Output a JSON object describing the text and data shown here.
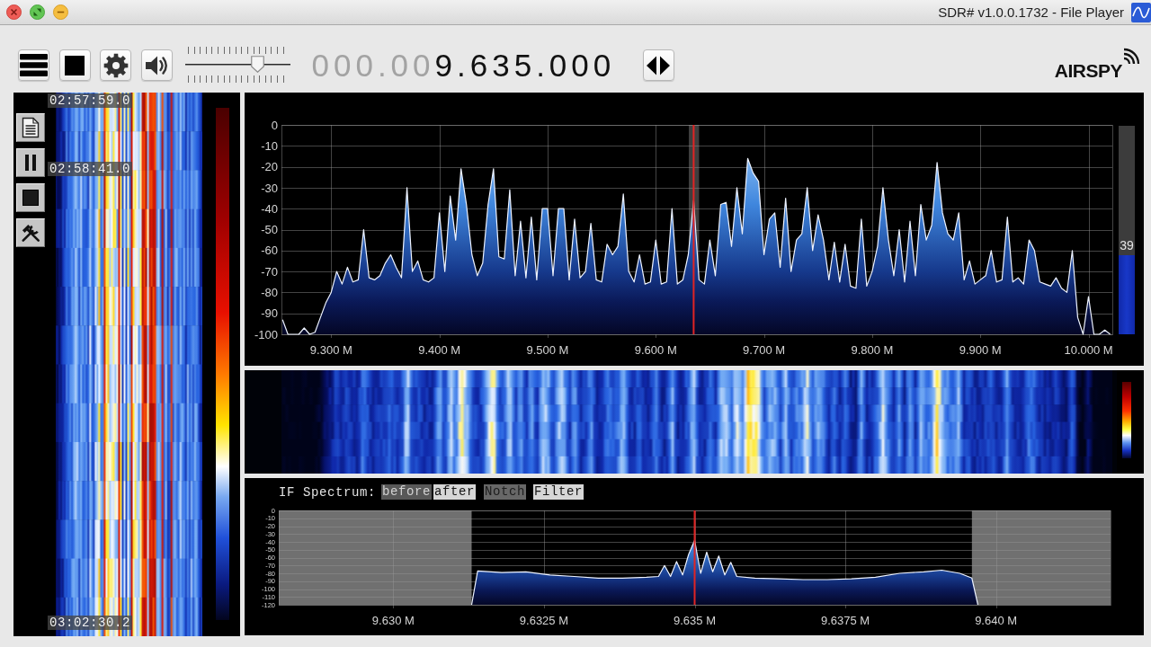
{
  "window": {
    "title": "SDR# v1.0.0.1732 - File Player"
  },
  "toolbar": {
    "volume": {
      "level": 0.69
    },
    "frequency": {
      "leading_zeros": "000.00",
      "digits": "9.635.000"
    },
    "logo": "AIRSPY"
  },
  "left_panel": {
    "timestamps": [
      "02:57:59.0",
      "02:58:41.0",
      "03:02:30.2"
    ]
  },
  "spectrum": {
    "chart_data": {
      "type": "area",
      "color": "#3f86dd",
      "x": [
        9.255,
        9.26,
        9.265,
        9.27,
        9.275,
        9.28,
        9.285,
        9.29,
        9.295,
        9.3,
        9.305,
        9.31,
        9.315,
        9.32,
        9.325,
        9.33,
        9.335,
        9.34,
        9.345,
        9.35,
        9.355,
        9.36,
        9.365,
        9.37,
        9.375,
        9.38,
        9.385,
        9.39,
        9.395,
        9.4,
        9.405,
        9.41,
        9.415,
        9.42,
        9.425,
        9.43,
        9.435,
        9.44,
        9.445,
        9.45,
        9.455,
        9.46,
        9.465,
        9.47,
        9.475,
        9.48,
        9.485,
        9.49,
        9.495,
        9.5,
        9.505,
        9.51,
        9.515,
        9.52,
        9.525,
        9.53,
        9.535,
        9.54,
        9.545,
        9.55,
        9.555,
        9.56,
        9.565,
        9.57,
        9.575,
        9.58,
        9.585,
        9.59,
        9.595,
        9.6,
        9.605,
        9.61,
        9.615,
        9.62,
        9.625,
        9.63,
        9.635,
        9.64,
        9.645,
        9.65,
        9.655,
        9.66,
        9.665,
        9.67,
        9.675,
        9.68,
        9.685,
        9.69,
        9.695,
        9.7,
        9.705,
        9.71,
        9.715,
        9.72,
        9.725,
        9.73,
        9.735,
        9.74,
        9.745,
        9.75,
        9.755,
        9.76,
        9.765,
        9.77,
        9.775,
        9.78,
        9.785,
        9.79,
        9.795,
        9.8,
        9.805,
        9.81,
        9.815,
        9.82,
        9.825,
        9.83,
        9.835,
        9.84,
        9.845,
        9.85,
        9.855,
        9.86,
        9.865,
        9.87,
        9.875,
        9.88,
        9.885,
        9.89,
        9.895,
        9.9,
        9.905,
        9.91,
        9.915,
        9.92,
        9.925,
        9.93,
        9.935,
        9.94,
        9.945,
        9.95,
        9.955,
        9.96,
        9.965,
        9.97,
        9.975,
        9.98,
        9.985,
        9.99,
        9.995,
        10.0,
        10.005,
        10.01,
        10.015,
        10.02
      ],
      "values": [
        -93,
        -100,
        -100,
        -100,
        -97,
        -100,
        -99,
        -92,
        -85,
        -80,
        -70,
        -76,
        -68,
        -75,
        -74,
        -50,
        -73,
        -74,
        -72,
        -66,
        -62,
        -68,
        -73,
        -30,
        -70,
        -65,
        -74,
        -75,
        -73,
        -42,
        -70,
        -34,
        -55,
        -21,
        -38,
        -62,
        -72,
        -66,
        -38,
        -21,
        -63,
        -64,
        -31,
        -72,
        -46,
        -73,
        -44,
        -74,
        -40,
        -40,
        -72,
        -40,
        -40,
        -74,
        -45,
        -73,
        -70,
        -47,
        -74,
        -75,
        -57,
        -62,
        -58,
        -33,
        -70,
        -75,
        -62,
        -76,
        -75,
        -55,
        -76,
        -75,
        -40,
        -76,
        -74,
        -62,
        -36,
        -74,
        -76,
        -55,
        -72,
        -38,
        -37,
        -58,
        -30,
        -52,
        -16,
        -23,
        -27,
        -62,
        -45,
        -42,
        -68,
        -35,
        -70,
        -55,
        -52,
        -30,
        -60,
        -43,
        -55,
        -74,
        -56,
        -75,
        -57,
        -77,
        -78,
        -45,
        -77,
        -70,
        -58,
        -30,
        -55,
        -72,
        -50,
        -75,
        -46,
        -72,
        -38,
        -55,
        -48,
        -18,
        -42,
        -52,
        -55,
        -42,
        -74,
        -65,
        -76,
        -74,
        -72,
        -60,
        -75,
        -74,
        -44,
        -75,
        -73,
        -76,
        -55,
        -60,
        -75,
        -76,
        -77,
        -73,
        -78,
        -80,
        -60,
        -92,
        -100,
        -82,
        -100,
        -100,
        -98,
        -100
      ],
      "xlim": [
        9.254,
        10.022
      ],
      "ylim": [
        -100,
        0
      ],
      "xticks": [
        {
          "value": 9.3,
          "label": "9.300 M"
        },
        {
          "value": 9.4,
          "label": "9.400 M"
        },
        {
          "value": 9.5,
          "label": "9.500 M"
        },
        {
          "value": 9.6,
          "label": "9.600 M"
        },
        {
          "value": 9.7,
          "label": "9.700 M"
        },
        {
          "value": 9.8,
          "label": "9.800 M"
        },
        {
          "value": 9.9,
          "label": "9.900 M"
        },
        {
          "value": 10.0,
          "label": "10.000 M"
        }
      ],
      "yticks": [
        0,
        -10,
        -20,
        -30,
        -40,
        -50,
        -60,
        -70,
        -80,
        -90,
        -100
      ],
      "grid": true,
      "ref_lines": [
        {
          "axis": "x",
          "value": 9.635,
          "color": "#e02424"
        }
      ],
      "bands": [
        {
          "axis": "x",
          "from": 9.6305,
          "to": 9.64,
          "color": "#3e3e3e"
        }
      ]
    },
    "signal_meter": {
      "reading": "39",
      "level": 0.38
    }
  },
  "if_spectrum": {
    "label": "IF Spectrum:",
    "modes": [
      {
        "label": "before",
        "selected": false
      },
      {
        "label": "after",
        "selected": true
      }
    ],
    "toggles": [
      {
        "label": "Notch",
        "on": false
      },
      {
        "label": "Filter",
        "on": true
      }
    ],
    "chart_data": {
      "type": "area",
      "color": "#3f86dd",
      "x": [
        9.6313,
        9.6314,
        9.6318,
        9.6322,
        9.6326,
        9.633,
        9.6334,
        9.6338,
        9.6342,
        9.6344,
        9.6345,
        9.6346,
        9.6347,
        9.6348,
        9.6349,
        9.635,
        9.6351,
        9.6352,
        9.6353,
        9.6354,
        9.6355,
        9.6356,
        9.6357,
        9.636,
        9.6364,
        9.6368,
        9.6372,
        9.6376,
        9.638,
        9.6384,
        9.6388,
        9.6391,
        9.6394,
        9.6396,
        9.6397
      ],
      "values": [
        -120,
        -77,
        -79,
        -78,
        -82,
        -84,
        -86,
        -86,
        -85,
        -84,
        -70,
        -84,
        -65,
        -82,
        -56,
        -38,
        -80,
        -53,
        -78,
        -58,
        -82,
        -66,
        -84,
        -86,
        -87,
        -88,
        -88,
        -87,
        -85,
        -80,
        -78,
        -76,
        -80,
        -86,
        -120
      ],
      "xlim": [
        9.6281,
        9.6419
      ],
      "ylim": [
        -120,
        0
      ],
      "xticks": [
        {
          "value": 9.63,
          "label": "9.630 M"
        },
        {
          "value": 9.6325,
          "label": "9.6325 M"
        },
        {
          "value": 9.635,
          "label": "9.635 M"
        },
        {
          "value": 9.6375,
          "label": "9.6375 M"
        },
        {
          "value": 9.64,
          "label": "9.640 M"
        }
      ],
      "yticks": [
        0,
        -10,
        -20,
        -30,
        -40,
        -50,
        -60,
        -70,
        -80,
        -90,
        -100,
        -110,
        -120
      ],
      "grid": true,
      "ref_lines": [
        {
          "axis": "x",
          "value": 9.635,
          "color": "#e02424"
        }
      ],
      "bands": [
        {
          "axis": "x",
          "from": 9.6281,
          "to": 9.6313,
          "color": "#707070"
        },
        {
          "axis": "x",
          "from": 9.6396,
          "to": 9.6419,
          "color": "#707070"
        }
      ]
    }
  }
}
